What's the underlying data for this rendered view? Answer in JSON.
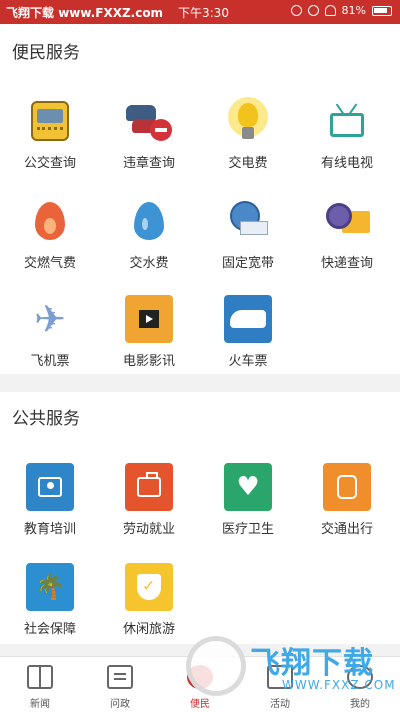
{
  "status_bar": {
    "watermark_part1": "飞翔下载",
    "watermark_part2": " www.FXXZ.com",
    "time": "下午3:30",
    "battery": "81%"
  },
  "sections": {
    "convenience": {
      "title": "便民服务",
      "items": [
        {
          "label": "公交查询",
          "icon": "bus-icon"
        },
        {
          "label": "违章查询",
          "icon": "traffic-violation-icon"
        },
        {
          "label": "交电费",
          "icon": "lightbulb-icon"
        },
        {
          "label": "有线电视",
          "icon": "tv-icon"
        },
        {
          "label": "交燃气费",
          "icon": "flame-icon"
        },
        {
          "label": "交水费",
          "icon": "water-drop-icon"
        },
        {
          "label": "固定宽带",
          "icon": "globe-computer-icon"
        },
        {
          "label": "快递查询",
          "icon": "delivery-truck-icon"
        },
        {
          "label": "飞机票",
          "icon": "airplane-icon"
        },
        {
          "label": "电影影讯",
          "icon": "film-icon"
        },
        {
          "label": "火车票",
          "icon": "train-icon"
        }
      ]
    },
    "public": {
      "title": "公共服务",
      "items": [
        {
          "label": "教育培训",
          "icon": "education-icon"
        },
        {
          "label": "劳动就业",
          "icon": "briefcase-icon"
        },
        {
          "label": "医疗卫生",
          "icon": "medical-heart-icon"
        },
        {
          "label": "交通出行",
          "icon": "bus-icon"
        },
        {
          "label": "社会保障",
          "icon": "palm-tree-icon"
        },
        {
          "label": "休闲旅游",
          "icon": "shield-check-icon"
        }
      ]
    }
  },
  "tabbar": {
    "tabs": [
      {
        "label": "新闻",
        "icon": "news-icon"
      },
      {
        "label": "问政",
        "icon": "message-icon"
      },
      {
        "label": "便民",
        "icon": "convenience-icon",
        "active": true
      },
      {
        "label": "活动",
        "icon": "activity-icon"
      },
      {
        "label": "我的",
        "icon": "profile-icon"
      }
    ]
  },
  "watermark": {
    "text": "飞翔下载",
    "url": "WWW.FXXZ.COM"
  },
  "colors": {
    "status_bar": "#c8302b",
    "active_tab": "#c8302b",
    "watermark": "#3fa9e8"
  }
}
